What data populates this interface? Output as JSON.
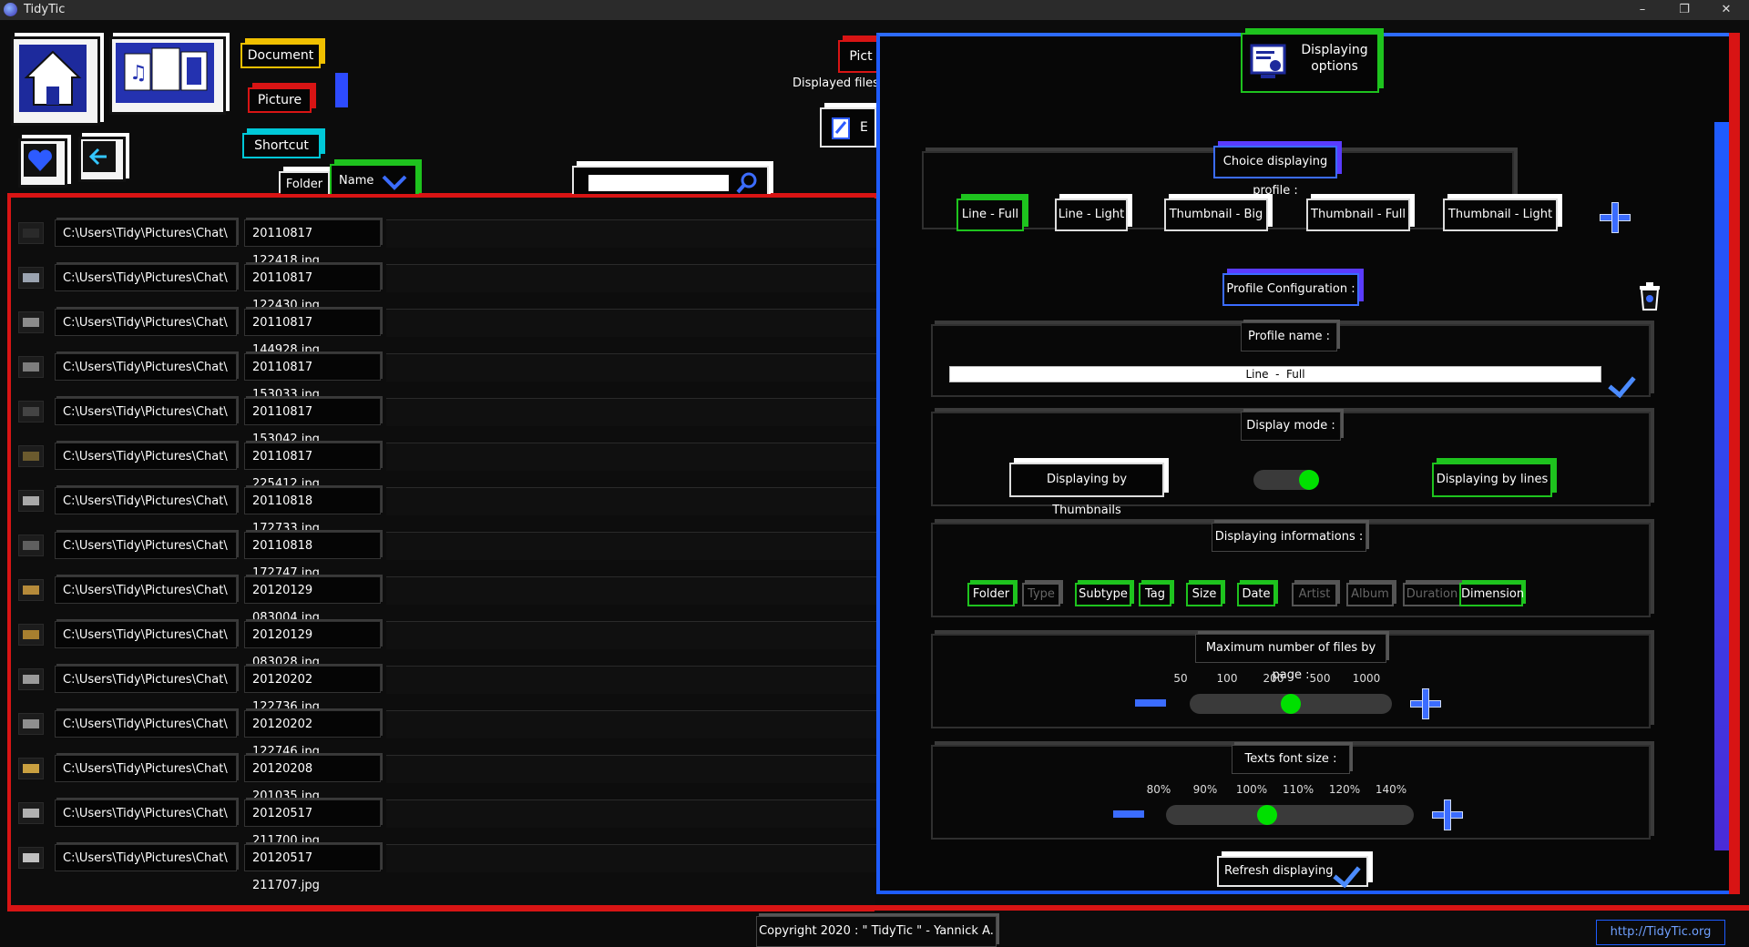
{
  "window": {
    "title": "TidyTic",
    "minimize": "–",
    "restore": "❐",
    "close": "✕"
  },
  "toolbar": {
    "categories": [
      "Document",
      "Picture",
      "Shortcut"
    ],
    "sort": {
      "folder_label": "Folder",
      "name_label": "Name"
    },
    "partial_tab": "Pict",
    "displayed_files_label": "Displayed files",
    "partial_edit": "E",
    "search_value": ""
  },
  "files": [
    {
      "folder": "C:\\Users\\Tidy\\Pictures\\Chat\\",
      "name": "20110817 122418.jpg",
      "thumb": "#2a2a2a"
    },
    {
      "folder": "C:\\Users\\Tidy\\Pictures\\Chat\\",
      "name": "20110817 122430.jpg",
      "thumb": "#9aa3b0"
    },
    {
      "folder": "C:\\Users\\Tidy\\Pictures\\Chat\\",
      "name": "20110817 144928.jpg",
      "thumb": "#8c8c8c"
    },
    {
      "folder": "C:\\Users\\Tidy\\Pictures\\Chat\\",
      "name": "20110817 153033.jpg",
      "thumb": "#7d7d7d"
    },
    {
      "folder": "C:\\Users\\Tidy\\Pictures\\Chat\\",
      "name": "20110817 153042.jpg",
      "thumb": "#444444"
    },
    {
      "folder": "C:\\Users\\Tidy\\Pictures\\Chat\\",
      "name": "20110817 225412.jpg",
      "thumb": "#6b5a2e"
    },
    {
      "folder": "C:\\Users\\Tidy\\Pictures\\Chat\\",
      "name": "20110818 172733.jpg",
      "thumb": "#a9a9a9"
    },
    {
      "folder": "C:\\Users\\Tidy\\Pictures\\Chat\\",
      "name": "20110818 172747.jpg",
      "thumb": "#5f5f5f"
    },
    {
      "folder": "C:\\Users\\Tidy\\Pictures\\Chat\\",
      "name": "20120129 083004.jpg",
      "thumb": "#b58a3a"
    },
    {
      "folder": "C:\\Users\\Tidy\\Pictures\\Chat\\",
      "name": "20120129 083028.jpg",
      "thumb": "#a77f2f"
    },
    {
      "folder": "C:\\Users\\Tidy\\Pictures\\Chat\\",
      "name": "20120202 122736.jpg",
      "thumb": "#9a9a9a"
    },
    {
      "folder": "C:\\Users\\Tidy\\Pictures\\Chat\\",
      "name": "20120202 122746.jpg",
      "thumb": "#8f8f8f"
    },
    {
      "folder": "C:\\Users\\Tidy\\Pictures\\Chat\\",
      "name": "20120208 201035.jpg",
      "thumb": "#c9a040"
    },
    {
      "folder": "C:\\Users\\Tidy\\Pictures\\Chat\\",
      "name": "20120517 211700.jpg",
      "thumb": "#b0b0b0"
    },
    {
      "folder": "C:\\Users\\Tidy\\Pictures\\Chat\\",
      "name": "20120517 211707.jpg",
      "thumb": "#c0c0c0"
    }
  ],
  "panel": {
    "title": "Displaying options",
    "choice_header": "Choice displaying profile :",
    "profiles": [
      "Line - Full",
      "Line - Light",
      "Thumbnail - Big",
      "Thumbnail - Full",
      "Thumbnail - Light"
    ],
    "config_header": "Profile Configuration :",
    "profile_name_label": "Profile name :",
    "profile_name_value": "Line  -  Full",
    "display_mode_label": "Display mode :",
    "mode_thumbnails": "Displaying by Thumbnails",
    "mode_lines": "Displaying by lines",
    "mode_toggle_on": true,
    "info_label": "Displaying informations :",
    "infos": [
      {
        "label": "Folder",
        "on": true
      },
      {
        "label": "Type",
        "on": false
      },
      {
        "label": "Subtype",
        "on": true
      },
      {
        "label": "Tag",
        "on": true
      },
      {
        "label": "Size",
        "on": true
      },
      {
        "label": "Date",
        "on": true
      },
      {
        "label": "Artist",
        "on": false
      },
      {
        "label": "Album",
        "on": false
      },
      {
        "label": "Duration",
        "on": false
      },
      {
        "label": "Dimension",
        "on": true
      }
    ],
    "max_files_label": "Maximum number of files by page :",
    "max_files_ticks": [
      "50",
      "100",
      "200",
      "500",
      "1000"
    ],
    "max_files_value": "200",
    "font_size_label": "Texts font size :",
    "font_ticks": [
      "80%",
      "90%",
      "100%",
      "110%",
      "120%",
      "140%"
    ],
    "font_value": "100%",
    "refresh_label": "Refresh displaying"
  },
  "footer": {
    "copyright": "Copyright 2020 : \" TidyTic \" - Yannick A.",
    "link": "http://TidyTic.org"
  },
  "colors": {
    "accent_blue": "#1e5cff",
    "accent_red": "#d81414",
    "accent_green": "#1ec31e"
  }
}
